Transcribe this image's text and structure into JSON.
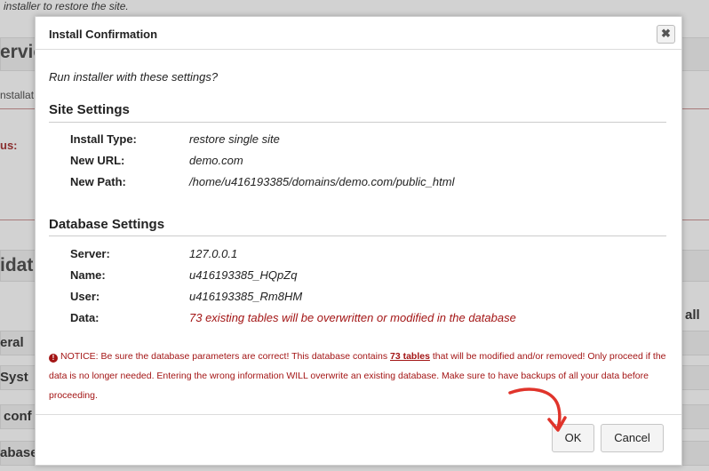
{
  "background": {
    "top_text": "installer to restore the site.",
    "heading_1": "ervic",
    "small_1": "nstallat",
    "status_label": "us:",
    "heading_2": "idat",
    "all_label": "all",
    "rows": [
      "eral",
      "Syst",
      "conf",
      "abase"
    ]
  },
  "modal": {
    "title": "Install Confirmation",
    "close_label": "✖",
    "question": "Run installer with these settings?",
    "site_settings": {
      "title": "Site Settings",
      "rows": [
        {
          "label": "Install Type:",
          "value": "restore single site"
        },
        {
          "label": "New URL:",
          "value": "demo.com"
        },
        {
          "label": "New Path:",
          "value": "/home/u416193385/domains/demo.com/public_html"
        }
      ]
    },
    "database_settings": {
      "title": "Database Settings",
      "rows": [
        {
          "label": "Server:",
          "value": "127.0.0.1"
        },
        {
          "label": "Name:",
          "value": "u416193385_HQpZq"
        },
        {
          "label": "User:",
          "value": "u416193385_Rm8HM"
        },
        {
          "label": "Data:",
          "value": "73 existing tables will be overwritten or modified in the database"
        }
      ]
    },
    "notice": {
      "prefix": "NOTICE: Be sure the database parameters are correct! This database contains ",
      "tables_link": "73 tables",
      "suffix": " that will be modified and/or removed! Only proceed if the data is no longer needed. Entering the wrong information WILL overwrite an existing database. Make sure to have backups of all your data before proceeding."
    },
    "ok_label": "OK",
    "cancel_label": "Cancel"
  },
  "colors": {
    "danger": "#a31515",
    "annotation_arrow": "#e0342b"
  }
}
